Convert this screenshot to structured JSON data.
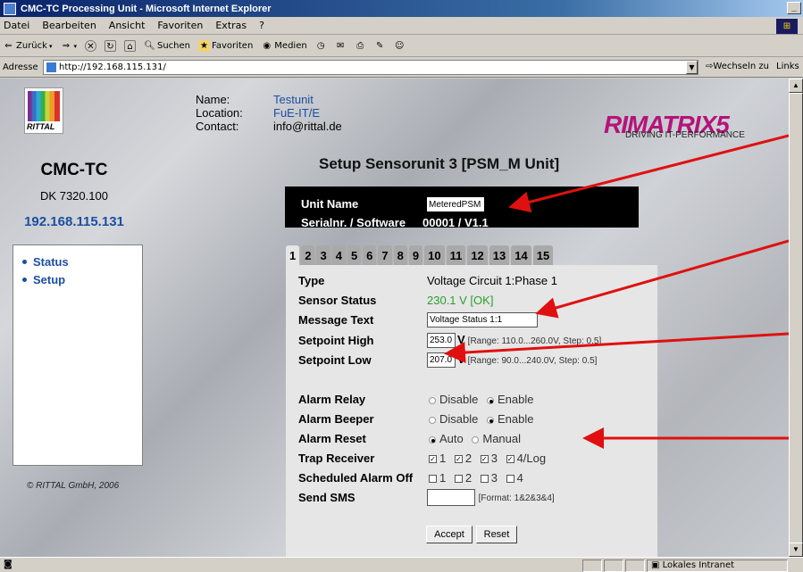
{
  "window": {
    "title": "CMC-TC Processing Unit - Microsoft Internet Explorer"
  },
  "menu": [
    "Datei",
    "Bearbeiten",
    "Ansicht",
    "Favoriten",
    "Extras",
    "?"
  ],
  "toolbar": {
    "back": "Zurück",
    "search": "Suchen",
    "favorites": "Favoriten",
    "media": "Medien"
  },
  "address": {
    "label": "Adresse",
    "url": "http://192.168.115.131/",
    "go": "Wechseln zu",
    "links": "Links"
  },
  "status_bar": {
    "zone": "Lokales Intranet"
  },
  "sidebar": {
    "brand": "RITTAL",
    "title": "CMC-TC",
    "model": "DK 7320.100",
    "ip": "192.168.115.131",
    "nav": [
      {
        "label": "Status"
      },
      {
        "label": "Setup"
      }
    ],
    "copyright": "© RITTAL GmbH, 2006"
  },
  "info": {
    "name_label": "Name:",
    "name_value": "Testunit",
    "location_label": "Location:",
    "location_value": "FuE-IT/E",
    "contact_label": "Contact:",
    "contact_value": "info@rittal.de"
  },
  "logo": {
    "word": "RIMATRIX5",
    "tagline": "DRIVING IT-PERFORMANCE"
  },
  "heading": "Setup Sensorunit 3 [PSM_M Unit]",
  "unit": {
    "name_label": "Unit Name",
    "name_value": "MeteredPSM",
    "serial_label": "Serialnr. / Software",
    "serial_value": "00001 / V1.1"
  },
  "tabs": [
    "1",
    "2",
    "3",
    "4",
    "5",
    "6",
    "7",
    "8",
    "9",
    "10",
    "11",
    "12",
    "13",
    "14",
    "15"
  ],
  "form": {
    "type_label": "Type",
    "type_value": "Voltage Circuit 1:Phase 1",
    "status_label": "Sensor Status",
    "status_value": "230.1 V [OK]",
    "message_label": "Message Text",
    "message_value": "Voltage Status 1:1",
    "high_label": "Setpoint High",
    "high_value": "253.0",
    "high_unit": "V",
    "high_range": "[Range: 110.0...260.0V, Step: 0.5]",
    "low_label": "Setpoint Low",
    "low_value": "207.0",
    "low_unit": "V",
    "low_range": "[Range: 90.0...240.0V, Step: 0.5]",
    "relay_label": "Alarm Relay",
    "relay_opt1": "Disable",
    "relay_opt2": "Enable",
    "beeper_label": "Alarm Beeper",
    "beeper_opt1": "Disable",
    "beeper_opt2": "Enable",
    "reset_label": "Alarm Reset",
    "reset_opt1": "Auto",
    "reset_opt2": "Manual",
    "trap_label": "Trap Receiver",
    "trap_opts": [
      "1",
      "2",
      "3",
      "4/Log"
    ],
    "sched_label": "Scheduled Alarm Off",
    "sched_opts": [
      "1",
      "2",
      "3",
      "4"
    ],
    "sms_label": "Send SMS",
    "sms_format": "[Format: 1&2&3&4]",
    "accept": "Accept",
    "reset": "Reset"
  }
}
